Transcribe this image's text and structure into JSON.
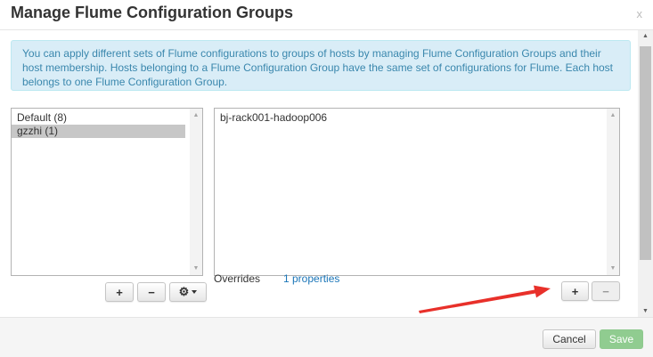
{
  "dialog": {
    "title": "Manage Flume Configuration Groups",
    "close_label": "x",
    "info_text": "You can apply different sets of Flume configurations to groups of hosts by managing Flume Configuration Groups and their host membership. Hosts belonging to a Flume Configuration Group have the same set of configurations for Flume. Each host belongs to one Flume Configuration Group."
  },
  "groups": {
    "items": [
      {
        "label": "Default (8)",
        "selected": false
      },
      {
        "label": "gzzhi (1)",
        "selected": true
      }
    ],
    "buttons": {
      "add": "+",
      "remove": "−",
      "settings": "⚙"
    }
  },
  "hosts": {
    "items": [
      {
        "label": "bj-rack001-hadoop006"
      }
    ],
    "buttons": {
      "add": "+",
      "remove": "−"
    }
  },
  "overrides": {
    "label": "Overrides",
    "link": "1 properties"
  },
  "footer": {
    "cancel": "Cancel",
    "save": "Save"
  },
  "colors": {
    "alert_bg": "#d9edf7",
    "alert_text": "#3a87ad",
    "link": "#1a75b8",
    "save_bg": "#90cc90",
    "annotation_arrow": "#e8302a"
  }
}
